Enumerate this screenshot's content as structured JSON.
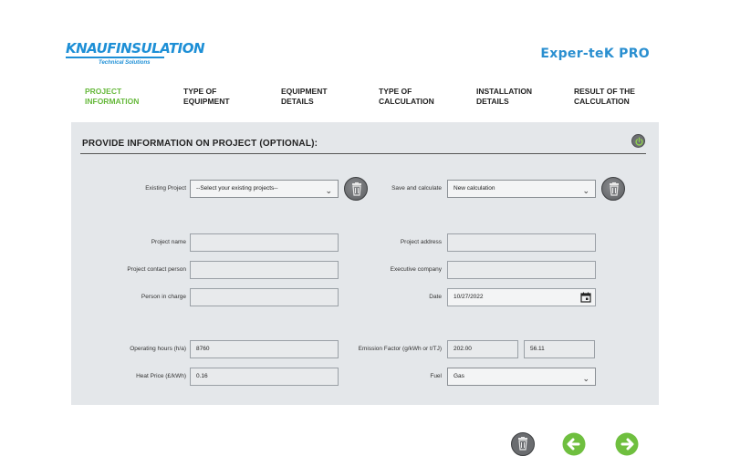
{
  "header": {
    "logo_main": "KNAUFINSULATION",
    "logo_sub": "Technical Solutions",
    "app_title": "Exper-teK PRO"
  },
  "steps": [
    {
      "label": "PROJECT\nINFORMATION",
      "active": true
    },
    {
      "label": "TYPE OF\nEQUIPMENT",
      "active": false
    },
    {
      "label": "EQUIPMENT\nDETAILS",
      "active": false
    },
    {
      "label": "TYPE OF\nCALCULATION",
      "active": false
    },
    {
      "label": "INSTALLATION\nDETAILS",
      "active": false
    },
    {
      "label": "RESULT OF THE\nCALCULATION",
      "active": false
    }
  ],
  "panel": {
    "title": "PROVIDE INFORMATION ON PROJECT (OPTIONAL):",
    "existing_project": {
      "label": "Existing Project",
      "value": "--Select your existing projects--"
    },
    "save_calc": {
      "label": "Save and calculate",
      "value": "New calculation"
    },
    "project_name": {
      "label": "Project name",
      "value": ""
    },
    "project_address": {
      "label": "Project address",
      "value": ""
    },
    "contact_person": {
      "label": "Project contact person",
      "value": ""
    },
    "executive_company": {
      "label": "Executive company",
      "value": ""
    },
    "person_in_charge": {
      "label": "Person in charge",
      "value": ""
    },
    "date": {
      "label": "Date",
      "value": "10/27/2022"
    },
    "operating_hours": {
      "label": "Operating hours (h/a)",
      "value": "8760"
    },
    "emission_factor": {
      "label": "Emission Factor (g/kWh or t/TJ)",
      "value1": "202.00",
      "value2": "56.11"
    },
    "heat_price": {
      "label": "Heat Price (£/kWh)",
      "value": "0.16"
    },
    "fuel": {
      "label": "Fuel",
      "value": "Gas"
    }
  },
  "colors": {
    "accent_blue": "#1d8fd6",
    "active_step": "#67b93c",
    "panel_bg": "#e4e7ea",
    "nav_green": "#6fbf3f"
  }
}
